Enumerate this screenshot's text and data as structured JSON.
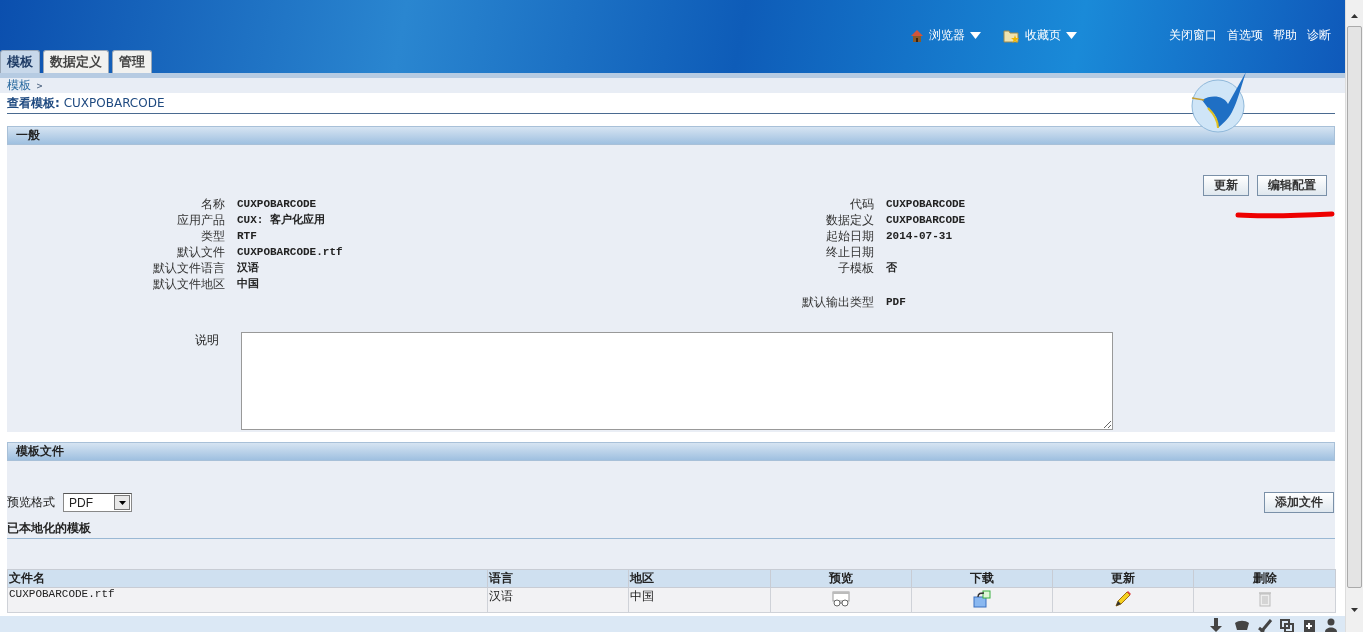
{
  "header": {
    "nav_menus": [
      {
        "label": "浏览器",
        "kind": "home"
      },
      {
        "label": "收藏页",
        "kind": "favorites"
      }
    ],
    "global_links": [
      "关闭窗口",
      "首选项",
      "帮助",
      "诊断"
    ]
  },
  "tabs": [
    {
      "label": "模板",
      "selected": true
    },
    {
      "label": "数据定义",
      "selected": false
    },
    {
      "label": "管理",
      "selected": false
    }
  ],
  "breadcrumb": [
    "模板"
  ],
  "page_title": {
    "label": "查看模板:",
    "value": "CUXPOBARCODE"
  },
  "general": {
    "title": "一般",
    "buttons": [
      "更新",
      "编辑配置"
    ],
    "left_fields": [
      {
        "label": "名称",
        "value": "CUXPOBARCODE"
      },
      {
        "label": "应用产品",
        "value": "CUX: 客户化应用"
      },
      {
        "label": "类型",
        "value": "RTF"
      },
      {
        "label": "默认文件",
        "value": "CUXPOBARCODE.rtf"
      },
      {
        "label": "默认文件语言",
        "value": "汉语"
      },
      {
        "label": "默认文件地区",
        "value": "中国"
      }
    ],
    "right_fields": [
      {
        "label": "代码",
        "value": "CUXPOBARCODE"
      },
      {
        "label": "数据定义",
        "value": "CUXPOBARCODE"
      },
      {
        "label": "起始日期",
        "value": "2014-07-31"
      },
      {
        "label": "终止日期"
      },
      {
        "label": "子模板",
        "value": "否"
      }
    ],
    "output_field": {
      "label": "默认输出类型",
      "value": "PDF"
    },
    "description": {
      "label": "说明"
    }
  },
  "template_files": {
    "title": "模板文件",
    "preview_format": {
      "label": "预览格式",
      "value": "PDF"
    },
    "add_button": "添加文件",
    "localized_title": "已本地化的模板",
    "table": {
      "columns": [
        {
          "label": "文件名",
          "kind": "text"
        },
        {
          "label": "语言",
          "kind": "text"
        },
        {
          "label": "地区",
          "kind": "text"
        },
        {
          "label": "预览",
          "kind": "preview"
        },
        {
          "label": "下载",
          "kind": "download"
        },
        {
          "label": "更新",
          "kind": "update"
        },
        {
          "label": "删除",
          "kind": "delete"
        }
      ],
      "rows": [
        {
          "cells": [
            "CUXPOBARCODE.rtf",
            "汉语",
            "中国"
          ]
        }
      ]
    }
  }
}
